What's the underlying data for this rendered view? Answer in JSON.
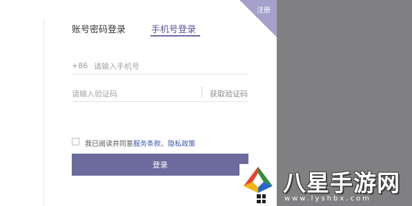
{
  "corner": {
    "register_label": "注册"
  },
  "tabs": [
    {
      "label": "账号密码登录",
      "active": false
    },
    {
      "label": "手机号登录",
      "active": true
    }
  ],
  "phone": {
    "prefix": "+86",
    "placeholder": "请输入手机号"
  },
  "code": {
    "placeholder": "请输入验证码",
    "get_code_label": "获取验证码"
  },
  "agreement": {
    "checked": false,
    "text": "我已阅读并同意",
    "terms_label": "服务条款",
    "separator": "、",
    "privacy_label": "隐私政策"
  },
  "login_label": "登录",
  "watermark": {
    "title": "八星手游网",
    "url": "www.lyshbx.com"
  },
  "colors": {
    "accent": "#6d6a9e",
    "active_tab": "#5b5591",
    "overlay": "#808083",
    "link": "#3b58b0"
  }
}
